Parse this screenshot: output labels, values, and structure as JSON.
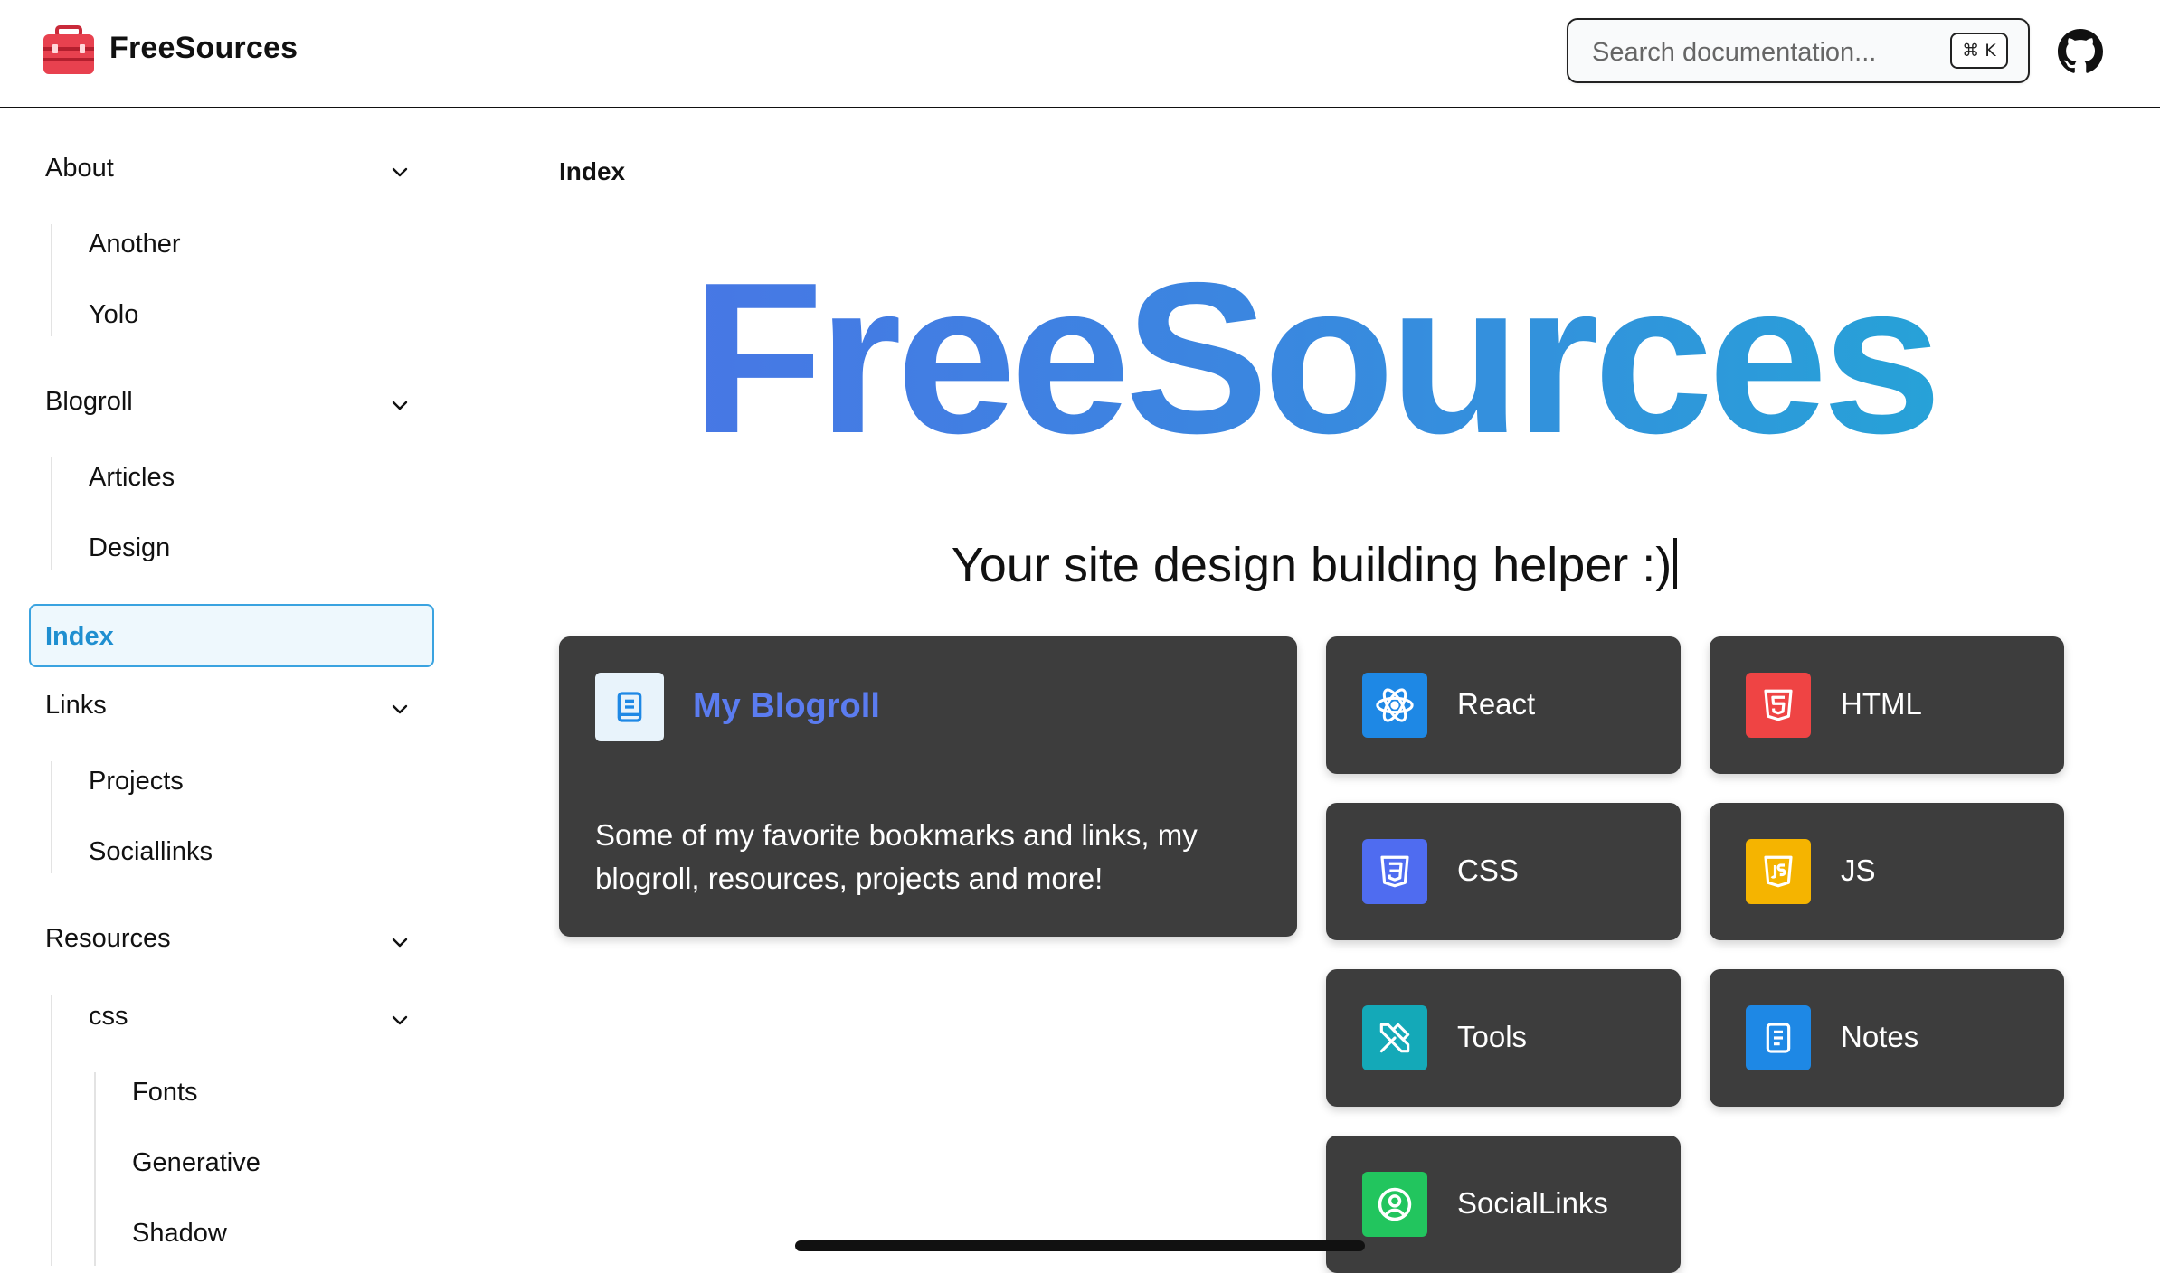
{
  "header": {
    "site_title": "FreeSources",
    "search_placeholder": "Search documentation...",
    "search_shortcut": "⌘ K",
    "logo_icon": "toolbox-icon",
    "github_icon": "github-icon"
  },
  "sidebar": {
    "groups": [
      {
        "label": "About",
        "items": [
          "Another",
          "Yolo"
        ]
      },
      {
        "label": "Blogroll",
        "items": [
          "Articles",
          "Design"
        ]
      },
      {
        "label": "Links",
        "items": [
          "Projects",
          "Sociallinks"
        ]
      },
      {
        "label": "Resources",
        "subgroup": {
          "label": "css",
          "items": [
            "Fonts",
            "Generative",
            "Shadow"
          ]
        }
      }
    ],
    "active": "Index"
  },
  "main": {
    "breadcrumb": "Index",
    "hero_title": "FreeSources",
    "tagline": "Your site design building helper :)",
    "featured_card": {
      "title": "My Blogroll",
      "description": "Some of my favorite bookmarks and links, my blogroll, resources, projects and more!",
      "icon": "book-icon"
    },
    "cards": [
      {
        "label": "React",
        "icon": "react-icon",
        "color": "#1e88e5"
      },
      {
        "label": "HTML",
        "icon": "html5-icon",
        "color": "#ef4444"
      },
      {
        "label": "CSS",
        "icon": "css3-icon",
        "color": "#4f6cf0"
      },
      {
        "label": "JS",
        "icon": "js-icon",
        "color": "#f5b400"
      },
      {
        "label": "Tools",
        "icon": "tools-icon",
        "color": "#14a9b8"
      },
      {
        "label": "Notes",
        "icon": "notes-icon",
        "color": "#1e88e5"
      },
      {
        "label": "SocialLinks",
        "icon": "user-circle-icon",
        "color": "#22c55e"
      }
    ]
  },
  "colors": {
    "accent": "#3aa3e0",
    "card_bg": "#3d3d3d",
    "blogroll_title": "#5b7cf0"
  }
}
